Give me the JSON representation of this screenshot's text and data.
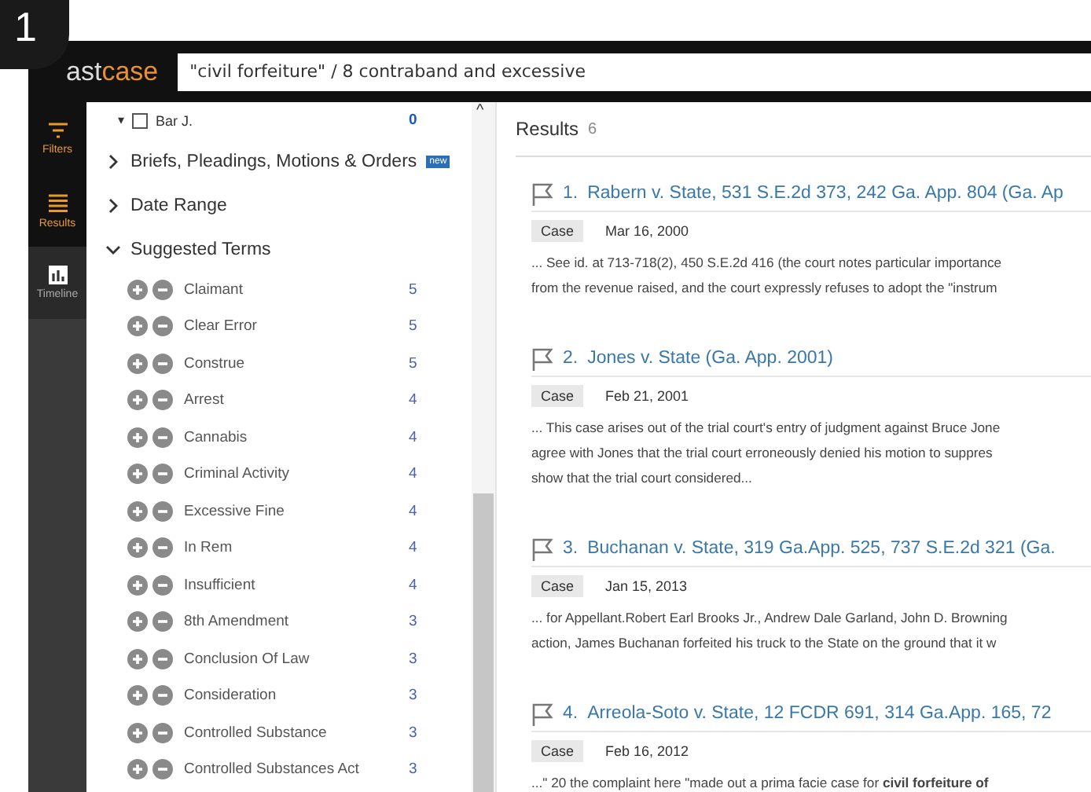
{
  "step_badge": "1",
  "app_bar": {
    "logo": {
      "dim": "ast",
      "accent": "case"
    },
    "search": {
      "value": "\"civil forfeiture\" / 8 contraband and excessive"
    }
  },
  "rail": [
    {
      "label": "Filters",
      "kind": "filter",
      "selected": true
    },
    {
      "label": "Results",
      "kind": "list",
      "selected": true
    },
    {
      "label": "Timeline",
      "kind": "chart",
      "selected": false
    }
  ],
  "filters": {
    "author": {
      "caret": "▾",
      "label": "Bar J.",
      "checked": false,
      "count": "0"
    },
    "scroll_up": "^",
    "sections": [
      {
        "label": "Briefs, Pleadings, Motions & Orders",
        "expanded": false,
        "badge": "new"
      },
      {
        "label": "Date Range",
        "expanded": false
      },
      {
        "label": "Suggested Terms",
        "expanded": true
      }
    ],
    "terms": [
      {
        "label": "Claimant",
        "count": "5"
      },
      {
        "label": "Clear Error",
        "count": "5"
      },
      {
        "label": "Construe",
        "count": "5"
      },
      {
        "label": "Arrest",
        "count": "4"
      },
      {
        "label": "Cannabis",
        "count": "4"
      },
      {
        "label": "Criminal Activity",
        "count": "4"
      },
      {
        "label": "Excessive Fine",
        "count": "4"
      },
      {
        "label": "In Rem",
        "count": "4"
      },
      {
        "label": "Insufficient",
        "count": "4"
      },
      {
        "label": "8th Amendment",
        "count": "3"
      },
      {
        "label": "Conclusion Of Law",
        "count": "3"
      },
      {
        "label": "Consideration",
        "count": "3"
      },
      {
        "label": "Controlled Substance",
        "count": "3"
      },
      {
        "label": "Controlled Substances Act",
        "count": "3"
      }
    ]
  },
  "results": {
    "heading": "Results",
    "count": "6",
    "items": [
      {
        "number": "1.",
        "title": "Rabern v. State, 531 S.E.2d 373, 242 Ga. App. 804 (Ga. Ap",
        "type": "Case",
        "date": "Mar 16, 2000",
        "snippet": [
          "... See id. at 713-718(2), 450 S.E.2d 416 (the court notes particular importance",
          "from the revenue raised, and the court expressly refuses to adopt the \"instrum"
        ]
      },
      {
        "number": "2.",
        "title": "Jones v. State (Ga. App. 2001)",
        "type": "Case",
        "date": "Feb 21, 2001",
        "snippet": [
          "... This case arises out of the trial court's entry of judgment against Bruce Jone",
          "agree with Jones that the trial court erroneously denied his motion to suppres",
          "show that the trial court considered..."
        ]
      },
      {
        "number": "3.",
        "title": "Buchanan v. State, 319 Ga.App. 525, 737 S.E.2d 321 (Ga.",
        "type": "Case",
        "date": "Jan 15, 2013",
        "snippet": [
          "... for Appellant.Robert Earl Brooks Jr., Andrew Dale Garland, John D. Browning",
          "action, James Buchanan forfeited his truck to the State on the ground that it w"
        ]
      },
      {
        "number": "4.",
        "title": "Arreola-Soto v. State, 12 FCDR 691, 314 Ga.App. 165, 72",
        "type": "Case",
        "date": "Feb 16, 2012",
        "snippet": [
          "...\" 20 the complaint here \"made out a prima facie case for **civil forfeiture of**"
        ]
      }
    ]
  }
}
